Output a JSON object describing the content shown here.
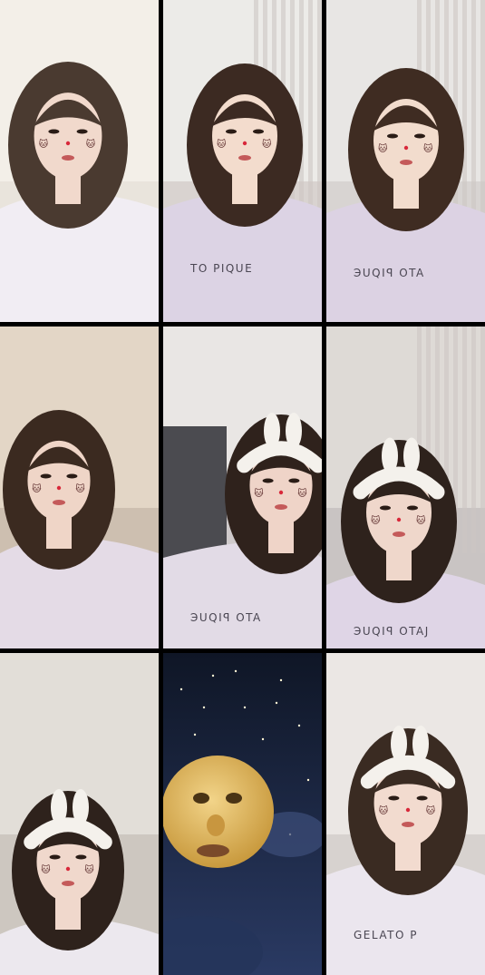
{
  "tiles": [
    {
      "bg": "#e9e4dc",
      "wall": "#f3efe8",
      "hair": "#4a3a30",
      "shirt": "#f1edf3",
      "skin": "#f1d9cc",
      "headband": false,
      "text": ""
    },
    {
      "bg": "#d9d3d0",
      "wall": "#ecebe8",
      "hair": "#3c2a22",
      "shirt": "#dcd3e4",
      "skin": "#f3dccd",
      "headband": false,
      "text": "TO PIQUE"
    },
    {
      "bg": "#d8d4d2",
      "wall": "#e8e6e4",
      "hair": "#3f2c22",
      "shirt": "#dcd2e3",
      "skin": "#f2dccd",
      "headband": false,
      "text": "ЭUQIꟼ OTA"
    },
    {
      "bg": "#cdbfb0",
      "wall": "#e3d6c6",
      "hair": "#3b2a20",
      "shirt": "#e4dbe6",
      "skin": "#efd5c7",
      "headband": false,
      "text": ""
    },
    {
      "bg": "#cfcacb",
      "wall": "#e9e6e4",
      "hair": "#2f221c",
      "shirt": "#e2dbe6",
      "skin": "#efd4c8",
      "headband": true,
      "text": "ЭUQIꟼ OTA"
    },
    {
      "bg": "#c9c4c3",
      "wall": "#dedad6",
      "hair": "#2e221c",
      "shirt": "#dfd5e6",
      "skin": "#efd7cb",
      "headband": true,
      "text": "ЭUQIꟼ OTAJ"
    },
    {
      "bg": "#cdc7c0",
      "wall": "#e2ded8",
      "hair": "#2e221c",
      "shirt": "#ece8ee",
      "skin": "#f0d8cc",
      "headband": true,
      "text": ""
    },
    {
      "bg": "#141c2e",
      "wall": "#1f2a44",
      "hair": "",
      "shirt": "",
      "skin": "",
      "headband": false,
      "text": ""
    },
    {
      "bg": "#d7d2cf",
      "wall": "#ebe7e4",
      "hair": "#3a2b22",
      "shirt": "#ebe6ee",
      "skin": "#f2dbcf",
      "headband": true,
      "text": "GELATO P"
    }
  ]
}
